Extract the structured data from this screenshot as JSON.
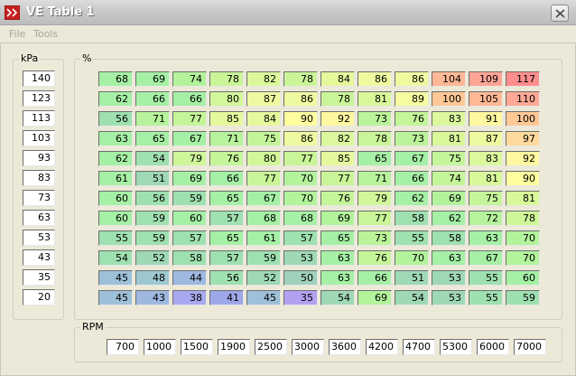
{
  "window": {
    "title": "VE Table 1",
    "icon": "engine-app-icon",
    "close_icon": "close-icon"
  },
  "menu": [
    {
      "label": "File"
    },
    {
      "label": "Tools"
    }
  ],
  "load_axis": {
    "label": "kPa",
    "values": [
      "140",
      "123",
      "113",
      "103",
      "93",
      "83",
      "73",
      "63",
      "53",
      "43",
      "35",
      "20"
    ]
  },
  "ve_table": {
    "label": "%",
    "rows": [
      [
        "68",
        "69",
        "74",
        "78",
        "82",
        "78",
        "84",
        "86",
        "86",
        "104",
        "109",
        "117"
      ],
      [
        "62",
        "66",
        "66",
        "80",
        "87",
        "86",
        "78",
        "81",
        "89",
        "100",
        "105",
        "110"
      ],
      [
        "56",
        "71",
        "77",
        "85",
        "84",
        "90",
        "92",
        "73",
        "76",
        "83",
        "91",
        "100"
      ],
      [
        "63",
        "65",
        "67",
        "71",
        "75",
        "86",
        "82",
        "78",
        "73",
        "81",
        "87",
        "97"
      ],
      [
        "62",
        "54",
        "79",
        "76",
        "80",
        "77",
        "85",
        "65",
        "67",
        "75",
        "83",
        "92"
      ],
      [
        "61",
        "51",
        "69",
        "66",
        "77",
        "70",
        "77",
        "71",
        "66",
        "74",
        "81",
        "90"
      ],
      [
        "60",
        "56",
        "59",
        "65",
        "67",
        "70",
        "76",
        "79",
        "62",
        "69",
        "75",
        "81"
      ],
      [
        "60",
        "59",
        "60",
        "57",
        "68",
        "68",
        "69",
        "77",
        "58",
        "62",
        "72",
        "78"
      ],
      [
        "55",
        "59",
        "57",
        "65",
        "61",
        "57",
        "65",
        "73",
        "55",
        "58",
        "63",
        "70"
      ],
      [
        "54",
        "52",
        "58",
        "57",
        "59",
        "53",
        "63",
        "76",
        "70",
        "63",
        "67",
        "70"
      ],
      [
        "45",
        "48",
        "44",
        "56",
        "52",
        "50",
        "63",
        "66",
        "51",
        "53",
        "55",
        "60"
      ],
      [
        "45",
        "43",
        "38",
        "41",
        "45",
        "35",
        "54",
        "69",
        "54",
        "53",
        "55",
        "59"
      ]
    ],
    "colors": [
      [
        "#a6f0a6",
        "#a6f0a6",
        "#b3f39c",
        "#c9f598",
        "#dbf89c",
        "#c9f598",
        "#e5f99c",
        "#eefaa0",
        "#eefaa0",
        "#ffb896",
        "#ffa596",
        "#ff8e8e"
      ],
      [
        "#a6f0a6",
        "#a6f0a6",
        "#a6f0a6",
        "#d2f79a",
        "#eefaa0",
        "#eefaa0",
        "#c9f598",
        "#d8f89a",
        "#f6fba2",
        "#ffc896",
        "#ffb896",
        "#ffa896"
      ],
      [
        "#9fe0b0",
        "#b7f39c",
        "#c5f599",
        "#e5f99c",
        "#e5f99c",
        "#ffffa0",
        "#fff8a0",
        "#bbf39a",
        "#c5f599",
        "#dbf89c",
        "#fff8a0",
        "#ffc896"
      ],
      [
        "#a6f0a6",
        "#a6f0a6",
        "#a6f0a6",
        "#b7f39c",
        "#c5f599",
        "#eefaa0",
        "#dbf89c",
        "#c9f598",
        "#bbf39a",
        "#d8f89a",
        "#eefaa0",
        "#ffda9c"
      ],
      [
        "#a6f0a6",
        "#9fe0b0",
        "#cff79a",
        "#c5f599",
        "#d2f79a",
        "#c9f598",
        "#e5f99c",
        "#a6f0a6",
        "#a6f0a6",
        "#c5f599",
        "#dbf89c",
        "#fff8a0"
      ],
      [
        "#a6f0a6",
        "#9fd8b4",
        "#a6f0a6",
        "#a6f0a6",
        "#c9f598",
        "#b3f39c",
        "#c9f598",
        "#b7f39c",
        "#a6f0a6",
        "#c5f599",
        "#d8f89a",
        "#ffffa0"
      ],
      [
        "#a6f0a6",
        "#9fe0b0",
        "#9fe0b0",
        "#a6f0a6",
        "#a6f0a6",
        "#b3f39c",
        "#c5f599",
        "#d2f79a",
        "#a6f0a6",
        "#b3f39c",
        "#c5f599",
        "#d8f89a"
      ],
      [
        "#a6f0a6",
        "#9fe0b0",
        "#a6f0a6",
        "#9fe0b0",
        "#a6f0a6",
        "#a6f0a6",
        "#b3f39c",
        "#c9f598",
        "#9fe0b0",
        "#a6f0a6",
        "#b7f39c",
        "#cff79a"
      ],
      [
        "#9fe0b0",
        "#9fe0b0",
        "#9fe0b0",
        "#a6f0a6",
        "#a6f0a6",
        "#9fe0b0",
        "#a6f0a6",
        "#bbf39a",
        "#9fe0b0",
        "#9fe0b0",
        "#a6f0a6",
        "#b3f39c"
      ],
      [
        "#9fe0b0",
        "#9fd8b4",
        "#9fe0b0",
        "#9fe0b0",
        "#9fe0b0",
        "#9fd8b4",
        "#a6f0a6",
        "#c5f599",
        "#b3f39c",
        "#a6f0a6",
        "#a6f0a6",
        "#b3f39c"
      ],
      [
        "#9ec0d8",
        "#9ec8d0",
        "#9eb8e0",
        "#9fe0b0",
        "#9fd8b4",
        "#9fd0bc",
        "#a6f0a6",
        "#a6f0a6",
        "#9fd8b4",
        "#9fd8b4",
        "#9fe0b0",
        "#a6f0a6"
      ],
      [
        "#9ec0d8",
        "#9eb8e0",
        "#a8a8f0",
        "#9ea8e8",
        "#9ec0d8",
        "#b4a0f0",
        "#9fd8b4",
        "#b3f39c",
        "#9fd8b4",
        "#9fd8b4",
        "#9fe0b0",
        "#9fe0b0"
      ]
    ]
  },
  "rpm_axis": {
    "label": "RPM",
    "values": [
      "700",
      "1000",
      "1500",
      "1900",
      "2500",
      "3000",
      "3600",
      "4200",
      "4700",
      "5300",
      "6000",
      "7000"
    ]
  }
}
